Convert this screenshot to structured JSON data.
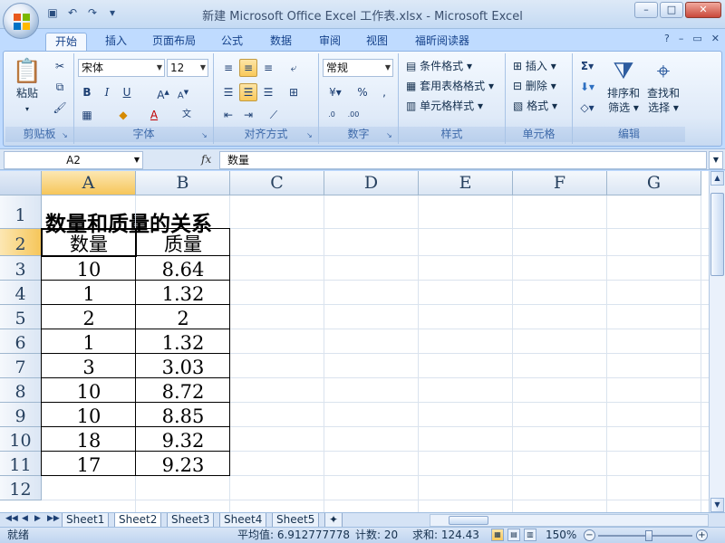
{
  "window": {
    "title": "新建 Microsoft Office Excel 工作表.xlsx - Microsoft Excel",
    "controls": [
      "–",
      "□",
      "✕"
    ]
  },
  "qat": {
    "icons": [
      "save-icon",
      "undo-icon",
      "redo-icon",
      "customize-icon"
    ]
  },
  "ribbon_tabs": [
    "开始",
    "插入",
    "页面布局",
    "公式",
    "数据",
    "审阅",
    "视图",
    "福昕阅读器"
  ],
  "active_tab": "开始",
  "ribbon": {
    "clipboard": {
      "label": "剪贴板",
      "paste": "粘贴"
    },
    "font": {
      "label": "字体",
      "name": "宋体",
      "size": "12"
    },
    "alignment": {
      "label": "对齐方式"
    },
    "number": {
      "label": "数字",
      "format": "常规"
    },
    "styles": {
      "label": "样式",
      "conditional": "条件格式",
      "table": "套用表格格式",
      "cell": "单元格样式"
    },
    "cells": {
      "label": "单元格",
      "insert": "插入",
      "delete": "删除",
      "format": "格式"
    },
    "editing": {
      "label": "编辑",
      "sort": "排序和\n筛选",
      "find": "查找和\n选择",
      "sort_1": "排序和",
      "sort_2": "筛选",
      "find_1": "查找和",
      "find_2": "选择"
    }
  },
  "formula_bar": {
    "name_box": "A2",
    "fx": "fx",
    "content": "数量"
  },
  "columns": [
    "A",
    "B",
    "C",
    "D",
    "E",
    "F",
    "G"
  ],
  "rows": [
    "1",
    "2",
    "3",
    "4",
    "5",
    "6",
    "7",
    "8",
    "9",
    "10",
    "11",
    "12"
  ],
  "sheet": {
    "title": "数量和质量的关系",
    "headers": [
      "数量",
      "质量"
    ],
    "data": [
      [
        "10",
        "8.64"
      ],
      [
        "1",
        "1.32"
      ],
      [
        "2",
        "2"
      ],
      [
        "1",
        "1.32"
      ],
      [
        "3",
        "3.03"
      ],
      [
        "10",
        "8.72"
      ],
      [
        "10",
        "8.85"
      ],
      [
        "18",
        "9.32"
      ],
      [
        "17",
        "9.23"
      ]
    ]
  },
  "sheet_tabs": [
    "Sheet1",
    "Sheet2",
    "Sheet3",
    "Sheet4",
    "Sheet5"
  ],
  "active_sheet": "Sheet2",
  "status": {
    "ready": "就绪",
    "average": "平均值: 6.912777778",
    "count": "计数: 20",
    "sum": "求和: 124.43",
    "zoom": "150%"
  },
  "colors": {
    "accent": "#bfdbff",
    "selection": "#f6c65a"
  }
}
